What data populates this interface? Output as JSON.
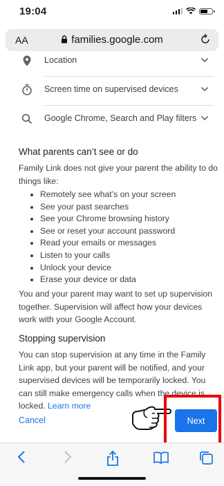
{
  "status_bar": {
    "time": "19:04"
  },
  "url_bar": {
    "text_size": "AA",
    "domain": "families.google.com"
  },
  "rows": [
    {
      "label": "Location",
      "icon": "location-pin-icon"
    },
    {
      "label": "Screen time on supervised devices",
      "icon": "timer-icon"
    },
    {
      "label": "Google Chrome, Search and Play filters",
      "icon": "search-icon"
    }
  ],
  "section1": {
    "heading": "What parents can’t see or do",
    "intro": "Family Link does not give your parent the ability to do things like:",
    "items": [
      "Remotely see what’s on your screen",
      "See your past searches",
      "See your Chrome browsing history",
      "See or reset your account password",
      "Read your emails or messages",
      "Listen to your calls",
      "Unlock your device",
      "Erase your device or data"
    ],
    "after": "You and your parent may want to set up supervision together. Supervision will affect how your devices work with your Google Account."
  },
  "section2": {
    "heading": "Stopping supervision",
    "body": "You can stop supervision at any time in the Family Link app, but your parent will be notified, and your supervised devices will be temporarily locked. You can still make emergency calls when the device is locked.",
    "link": "Learn more"
  },
  "actions": {
    "cancel": "Cancel",
    "next": "Next"
  },
  "colors": {
    "accent": "#1a73e8",
    "highlight": "#e8000b"
  },
  "toolbar_icons": [
    "back-icon",
    "forward-icon",
    "share-icon",
    "bookmarks-icon",
    "tabs-icon"
  ]
}
